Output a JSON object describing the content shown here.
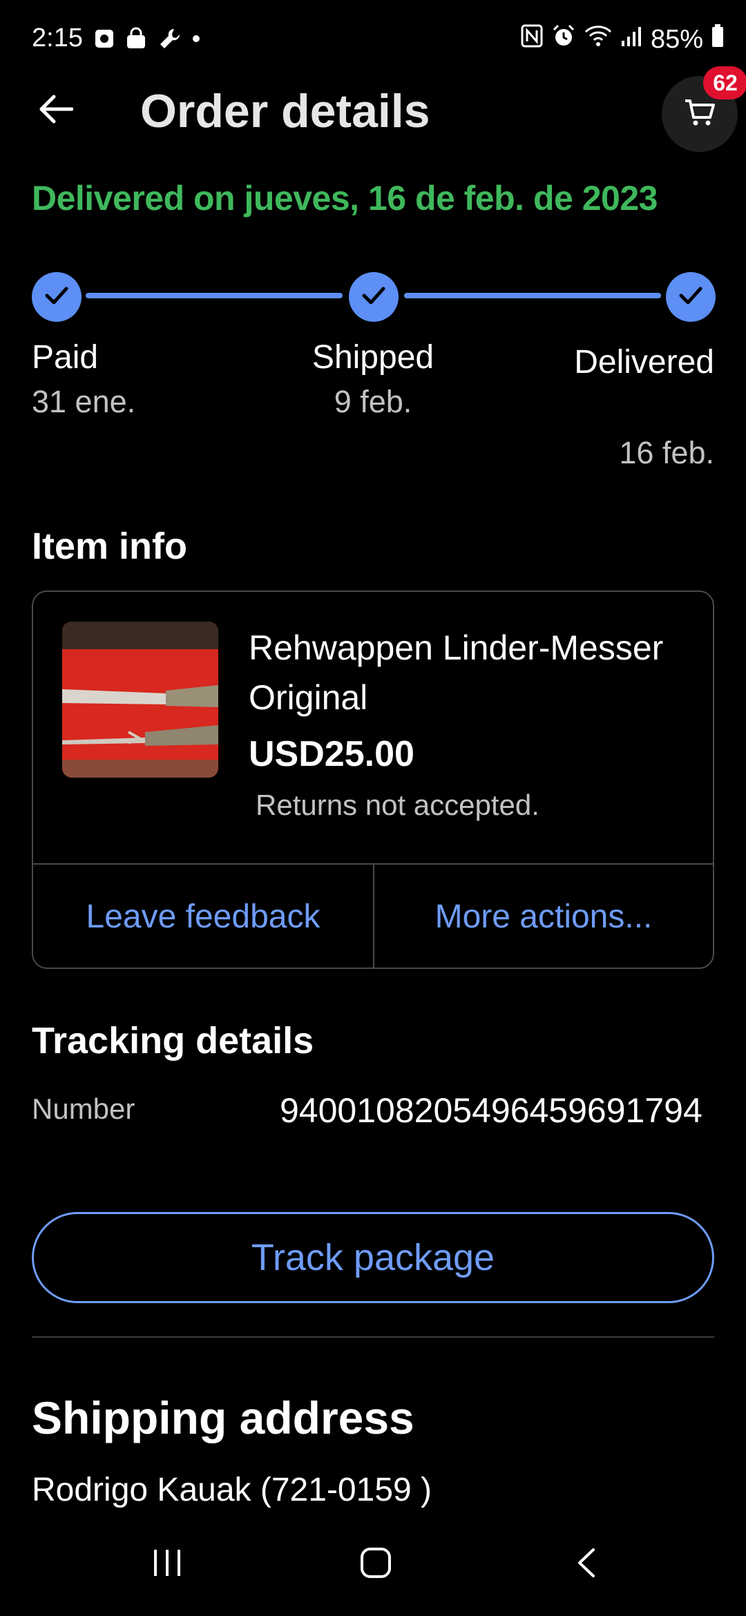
{
  "status_bar": {
    "time": "2:15",
    "battery": "85%",
    "left_icons": [
      "notification-icon",
      "shopping-bag-icon",
      "wrench-icon",
      "dot-icon"
    ],
    "right_icons": [
      "nfc-icon",
      "alarm-icon",
      "wifi-icon",
      "signal-icon",
      "battery-icon"
    ]
  },
  "header": {
    "title": "Order details",
    "cart_count": "62"
  },
  "delivery_status": "Delivered on jueves, 16 de feb. de 2023",
  "progress": {
    "steps": [
      {
        "label": "Paid",
        "date": "31 ene."
      },
      {
        "label": "Shipped",
        "date": "9 feb."
      },
      {
        "label": "Delivered",
        "date": "16 feb."
      }
    ]
  },
  "item_info": {
    "heading": "Item info",
    "title": "Rehwappen Linder-Messer Original",
    "price": "USD25.00",
    "returns": "Returns not accepted.",
    "actions": {
      "feedback": "Leave feedback",
      "more": "More actions..."
    }
  },
  "tracking": {
    "heading": "Tracking details",
    "number_label": "Number",
    "number_value": "9400108205496459691794",
    "button": "Track package"
  },
  "shipping": {
    "heading": "Shipping address",
    "name": "Rodrigo Kauak (721-0159 )"
  },
  "colors": {
    "background": "#000000",
    "accent": "#6f9cf8",
    "step": "#5d8ff5",
    "success": "#3fb85c",
    "badge": "#e0102f"
  }
}
